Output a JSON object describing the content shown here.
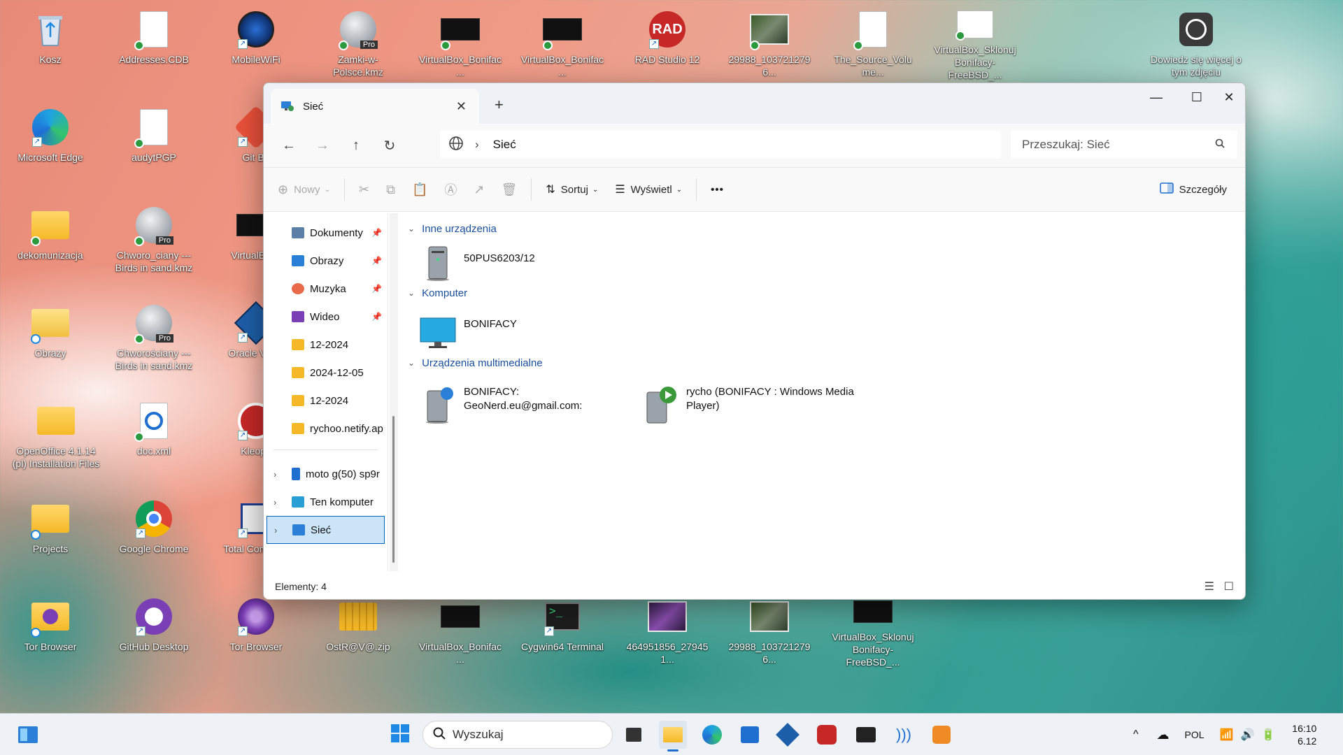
{
  "desktop": {
    "icons": [
      {
        "label": "Kosz"
      },
      {
        "label": "Addresses.CDB"
      },
      {
        "label": "MobileWiFi"
      },
      {
        "label": "Zamki-w-Polsce.kmz"
      },
      {
        "label": "VirtualBox_Bonifac..."
      },
      {
        "label": "VirtualBox_Bonifac..."
      },
      {
        "label": "RAD Studio 12"
      },
      {
        "label": "29988_1037212796..."
      },
      {
        "label": "The_Source_Volume..."
      },
      {
        "label": "VirtualBox_Sklonuj Bonifacy-FreeBSD_..."
      },
      {
        "label": "Dowiedz się więcej o tym zdjęciu"
      },
      {
        "label": "Microsoft Edge"
      },
      {
        "label": "audytPGP"
      },
      {
        "label": "Git Ba"
      },
      {
        "label": "dekomunizacja"
      },
      {
        "label": "Chworo_ciany --- Birds in sand.kmz"
      },
      {
        "label": "VirtualBox_"
      },
      {
        "label": "Obrazy"
      },
      {
        "label": "Chworościany --- Birds in sand.kmz"
      },
      {
        "label": "Oracle VM V"
      },
      {
        "label": "OpenOffice 4.1.14 (pl) Installation Files"
      },
      {
        "label": "doc.xml"
      },
      {
        "label": "Kleopa"
      },
      {
        "label": "Projects"
      },
      {
        "label": "Google Chrome"
      },
      {
        "label": "Total Comm bit"
      },
      {
        "label": "Tor Browser"
      },
      {
        "label": "GitHub Desktop"
      },
      {
        "label": "Tor Browser"
      },
      {
        "label": "OstR@V@.zip"
      },
      {
        "label": "VirtualBox_Bonifac..."
      },
      {
        "label": "Cygwin64 Terminal"
      },
      {
        "label": "464951856_279451..."
      },
      {
        "label": "29988_1037212796..."
      },
      {
        "label": "VirtualBox_Sklonuj Bonifacy-FreeBSD_..."
      }
    ],
    "pro_badge": "Pro",
    "rad_badge": "RAD"
  },
  "explorer": {
    "tab_title": "Sieć",
    "tab_close": "✕",
    "new_tab": "+",
    "window_controls": {
      "minimize": "—",
      "maximize": "☐",
      "close": "✕"
    },
    "nav": {
      "back": "←",
      "forward": "→",
      "up": "↑",
      "refresh": "↻",
      "separator": "›"
    },
    "address": "Sieć",
    "search_placeholder": "Przeszukaj: Sieć",
    "toolbar": {
      "new": "Nowy",
      "sort": "Sortuj",
      "view": "Wyświetl",
      "more": "•••",
      "details": "Szczegóły"
    },
    "sidebar": [
      {
        "label": "Dokumenty",
        "pinned": true
      },
      {
        "label": "Obrazy",
        "pinned": true
      },
      {
        "label": "Muzyka",
        "pinned": true
      },
      {
        "label": "Wideo",
        "pinned": true
      },
      {
        "label": "12-2024",
        "pinned": false
      },
      {
        "label": "2024-12-05",
        "pinned": false
      },
      {
        "label": "12-2024",
        "pinned": false
      },
      {
        "label": "rychoo.netify.ap",
        "pinned": false
      },
      {
        "label": "moto g(50) sp9r",
        "pinned": false
      },
      {
        "label": "Ten komputer",
        "pinned": false
      },
      {
        "label": "Sieć",
        "pinned": false
      }
    ],
    "pin_glyph": "📌",
    "groups": [
      {
        "title": "Inne urządzenia",
        "items": [
          {
            "label": "50PUS6203/12"
          }
        ]
      },
      {
        "title": "Komputer",
        "items": [
          {
            "label": "BONIFACY"
          }
        ]
      },
      {
        "title": "Urządzenia multimedialne",
        "items": [
          {
            "label": "BONIFACY: GeoNerd.eu@gmail.com:"
          },
          {
            "label": "rycho (BONIFACY : Windows Media Player)"
          }
        ]
      }
    ],
    "status": "Elementy: 4"
  },
  "taskbar": {
    "search_placeholder": "Wyszukaj",
    "tray": {
      "language": "POL",
      "time": "16:10",
      "date": "6.12"
    }
  }
}
